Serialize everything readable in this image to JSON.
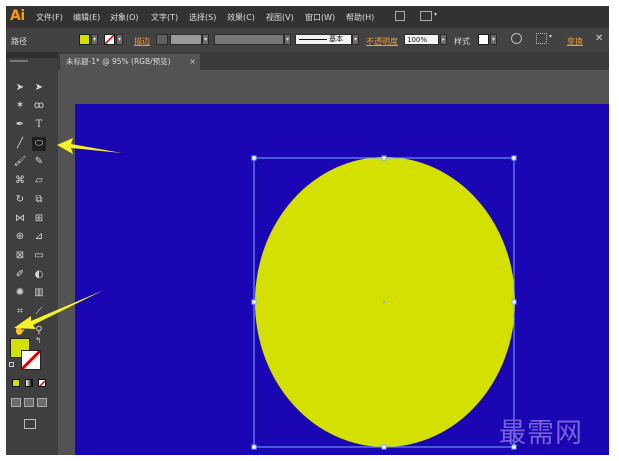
{
  "app": {
    "logo": "Ai"
  },
  "menu": {
    "items": [
      "文件(F)",
      "编辑(E)",
      "对象(O)",
      "文字(T)",
      "选择(S)",
      "效果(C)",
      "视图(V)",
      "窗口(W)",
      "帮助(H)"
    ]
  },
  "control_bar": {
    "selection_label": "路径",
    "fill_color": "#d4e000",
    "stroke_label": "描边",
    "stroke_style_label": "基本",
    "opacity_label": "不透明度",
    "opacity_value": "100%",
    "style_label": "样式",
    "transform_label": "变换"
  },
  "document": {
    "tab_title": "未标题-1* @ 95% (RGB/预览)",
    "close_glyph": "×",
    "artboard_color": "#1b06b3",
    "ellipse_fill": "#d4e000",
    "selection_color": "#7ea8ff"
  },
  "tools": {
    "fill_color": "#d4e000",
    "stroke_color": "#ffffff",
    "active_tool": "ellipse-tool"
  },
  "annotations": {
    "arrow_color": "#f2f226"
  },
  "watermark": "最需网"
}
